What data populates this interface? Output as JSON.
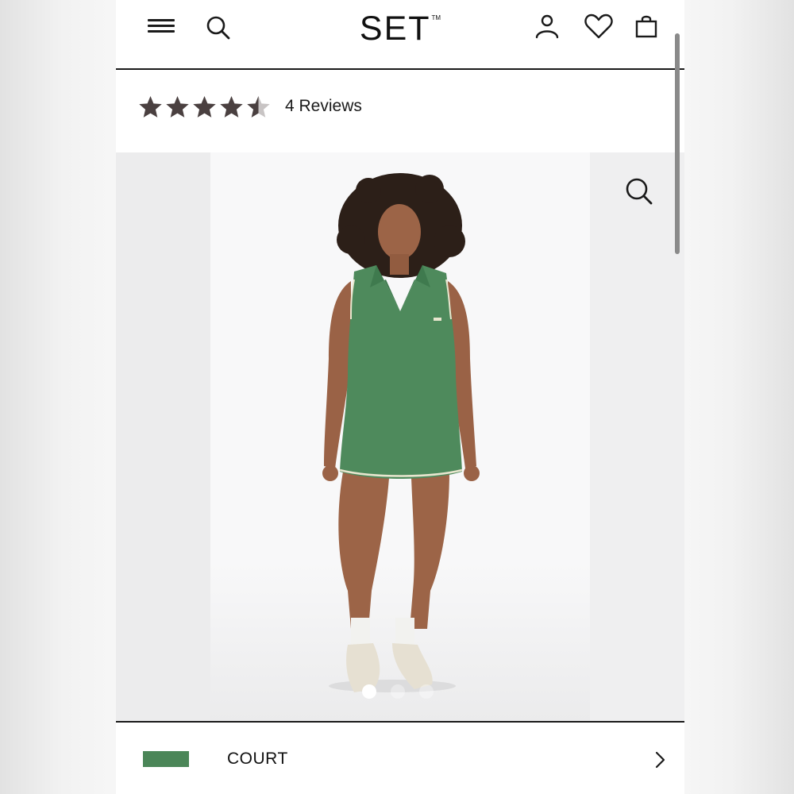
{
  "header": {
    "brand_name": "SET",
    "brand_tm": "TM",
    "icons": [
      "menu-icon",
      "search-icon",
      "account-icon",
      "wishlist-heart-icon",
      "shopping-bag-icon"
    ]
  },
  "rating": {
    "stars": 4.5,
    "max_stars": 5,
    "reviews_label": "4 Reviews"
  },
  "gallery": {
    "slide_count": 3,
    "active_slide": 1,
    "dress_color": "#4e8a5c"
  },
  "color_selector": {
    "name": "COURT",
    "swatch_color": "#4b8658"
  },
  "colors": {
    "text": "#1a1a1a",
    "star_fill": "#4a4040",
    "star_empty": "#c8c4c4"
  }
}
